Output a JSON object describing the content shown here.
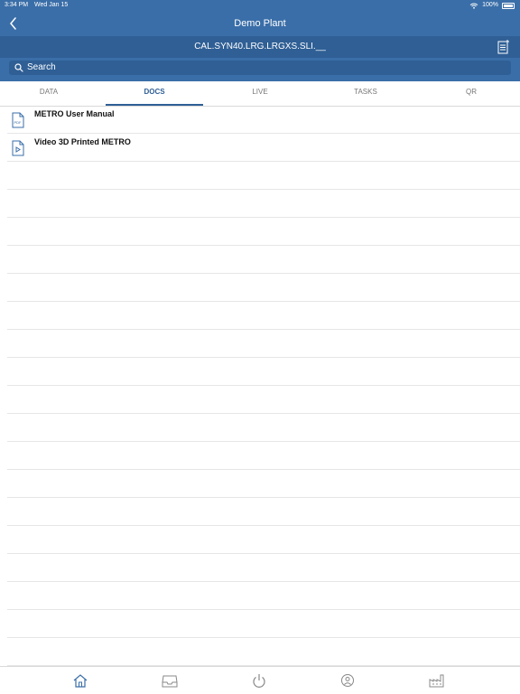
{
  "status": {
    "time": "3:34 PM",
    "date": "Wed Jan 15",
    "battery": "100%"
  },
  "nav": {
    "title": "Demo Plant"
  },
  "subheader": {
    "code": "CAL.SYN40.LRG.LRGXS.SLI.__"
  },
  "search": {
    "placeholder": "Search"
  },
  "tabs": [
    {
      "label": "DATA"
    },
    {
      "label": "DOCS"
    },
    {
      "label": "LIVE"
    },
    {
      "label": "TASKS"
    },
    {
      "label": "QR"
    }
  ],
  "docs": [
    {
      "label": "METRO User Manual",
      "icon": "pdf-file-icon"
    },
    {
      "label": "Video 3D Printed METRO",
      "icon": "video-file-icon"
    }
  ],
  "colors": {
    "header": "#3a6ea8",
    "subheader": "#2f5f95",
    "active_tab": "#2f5f95"
  }
}
